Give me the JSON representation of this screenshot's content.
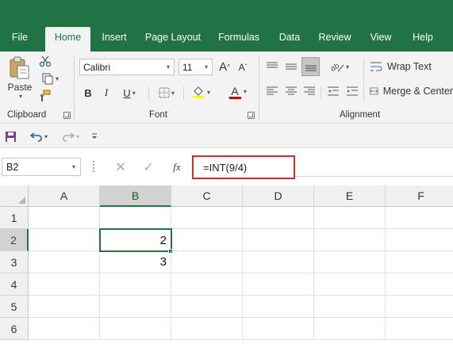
{
  "tabs": [
    {
      "label": "File",
      "active": false
    },
    {
      "label": "Home",
      "active": true
    },
    {
      "label": "Insert",
      "active": false
    },
    {
      "label": "Page Layout",
      "active": false
    },
    {
      "label": "Formulas",
      "active": false
    },
    {
      "label": "Data",
      "active": false
    },
    {
      "label": "Review",
      "active": false
    },
    {
      "label": "View",
      "active": false
    },
    {
      "label": "Help",
      "active": false
    }
  ],
  "ribbon": {
    "clipboard": {
      "paste_label": "Paste",
      "group_label": "Clipboard"
    },
    "font": {
      "font_name": "Calibri",
      "font_size": "11",
      "bold": "B",
      "italic": "I",
      "underline": "U",
      "grow": "A",
      "shrink": "A",
      "font_color_glyph": "A",
      "group_label": "Font"
    },
    "alignment": {
      "wrap_text_label": "Wrap Text",
      "merge_center_label": "Merge & Center",
      "group_label": "Alignment"
    }
  },
  "formula_bar": {
    "name_box": "B2",
    "formula": "=INT(9/4)",
    "fx_label": "fx"
  },
  "sheet": {
    "columns": [
      "A",
      "B",
      "C",
      "D",
      "E",
      "F"
    ],
    "rows": [
      "1",
      "2",
      "3",
      "4",
      "5",
      "6"
    ],
    "active_cell": "B2",
    "cells": {
      "B2": "2",
      "B3": "3"
    }
  },
  "colors": {
    "brand_green": "#217346",
    "highlight_box": "#c8303b",
    "fill_yellow": "#ffff00",
    "font_red": "#c00000"
  }
}
